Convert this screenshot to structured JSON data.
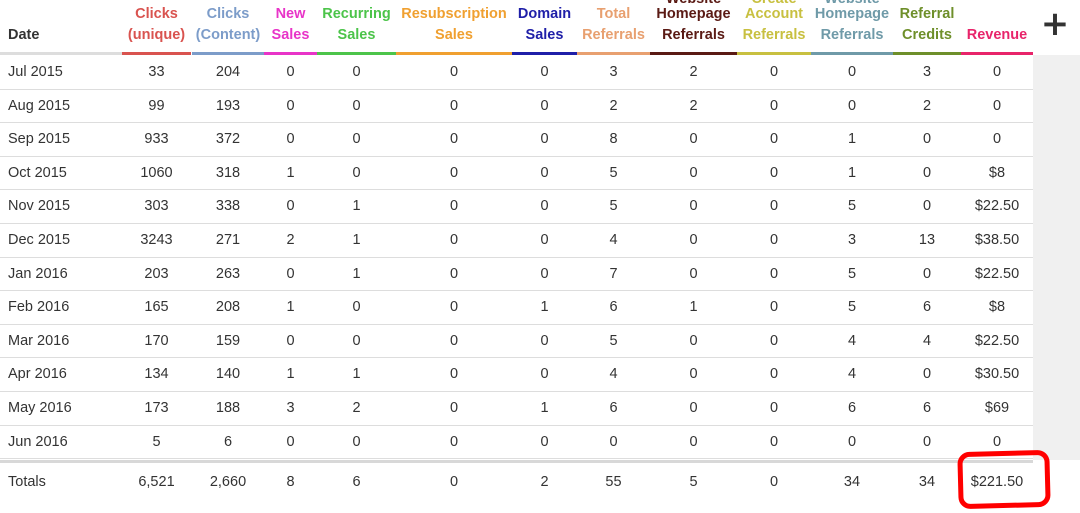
{
  "toolbar": {
    "add_icon_glyph": "+"
  },
  "columns": [
    {
      "key": "date",
      "label": "Date",
      "color": "#333333",
      "underline": "#dddddd"
    },
    {
      "key": "clicks_u",
      "label": "Clicks\n(unique)",
      "color": "#d9534f",
      "underline": "#d9534f"
    },
    {
      "key": "clicks_c",
      "label": "Clicks\n(Content)",
      "color": "#7c9cc9",
      "underline": "#7c9cc9"
    },
    {
      "key": "new",
      "label": "New\nSales",
      "color": "#e834c8",
      "underline": "#e834c8"
    },
    {
      "key": "recur",
      "label": "Recurring\nSales",
      "color": "#4cc44a",
      "underline": "#4cc44a"
    },
    {
      "key": "resub",
      "label": "Resubscription\nSales",
      "color": "#f0a030",
      "underline": "#f0a030"
    },
    {
      "key": "domain",
      "label": "Domain\nSales",
      "color": "#1f1fa8",
      "underline": "#1f1fa8"
    },
    {
      "key": "total_ref",
      "label": "Total\nReferrals",
      "color": "#e8a070",
      "underline": "#e8a070"
    },
    {
      "key": "home_ref",
      "label": "Homepage\nReferrals",
      "color": "#5a1a14",
      "underline": "#5a1a14",
      "cropped": "Website"
    },
    {
      "key": "acct_ref",
      "label": "Account\nReferrals",
      "color": "#c8c040",
      "underline": "#c8c040",
      "cropped": "Create"
    },
    {
      "key": "whome_ref",
      "label": "Homepage\nReferrals",
      "color": "#6f9aa8",
      "underline": "#6f9aa8",
      "cropped": "Website"
    },
    {
      "key": "ref_cred",
      "label": "Referral\nCredits",
      "color": "#6e8f2a",
      "underline": "#6e8f2a"
    },
    {
      "key": "revenue",
      "label": "Revenue",
      "color": "#e8246a",
      "underline": "#e8246a"
    }
  ],
  "rows": [
    [
      "Jul 2015",
      "33",
      "204",
      "0",
      "0",
      "0",
      "0",
      "3",
      "2",
      "0",
      "0",
      "3",
      "0"
    ],
    [
      "Aug 2015",
      "99",
      "193",
      "0",
      "0",
      "0",
      "0",
      "2",
      "2",
      "0",
      "0",
      "2",
      "0"
    ],
    [
      "Sep 2015",
      "933",
      "372",
      "0",
      "0",
      "0",
      "0",
      "8",
      "0",
      "0",
      "1",
      "0",
      "0"
    ],
    [
      "Oct 2015",
      "1060",
      "318",
      "1",
      "0",
      "0",
      "0",
      "5",
      "0",
      "0",
      "1",
      "0",
      "$8"
    ],
    [
      "Nov 2015",
      "303",
      "338",
      "0",
      "1",
      "0",
      "0",
      "5",
      "0",
      "0",
      "5",
      "0",
      "$22.50"
    ],
    [
      "Dec 2015",
      "3243",
      "271",
      "2",
      "1",
      "0",
      "0",
      "4",
      "0",
      "0",
      "3",
      "13",
      "$38.50"
    ],
    [
      "Jan 2016",
      "203",
      "263",
      "0",
      "1",
      "0",
      "0",
      "7",
      "0",
      "0",
      "5",
      "0",
      "$22.50"
    ],
    [
      "Feb 2016",
      "165",
      "208",
      "1",
      "0",
      "0",
      "1",
      "6",
      "1",
      "0",
      "5",
      "6",
      "$8"
    ],
    [
      "Mar 2016",
      "170",
      "159",
      "0",
      "0",
      "0",
      "0",
      "5",
      "0",
      "0",
      "4",
      "4",
      "$22.50"
    ],
    [
      "Apr 2016",
      "134",
      "140",
      "1",
      "1",
      "0",
      "0",
      "4",
      "0",
      "0",
      "4",
      "0",
      "$30.50"
    ],
    [
      "May 2016",
      "173",
      "188",
      "3",
      "2",
      "0",
      "1",
      "6",
      "0",
      "0",
      "6",
      "6",
      "$69"
    ],
    [
      "Jun 2016",
      "5",
      "6",
      "0",
      "0",
      "0",
      "0",
      "0",
      "0",
      "0",
      "0",
      "0",
      "0"
    ]
  ],
  "totals": [
    "Totals",
    "6,521",
    "2,660",
    "8",
    "6",
    "0",
    "2",
    "55",
    "5",
    "0",
    "34",
    "34",
    "$221.50"
  ],
  "annotation": {
    "color": "#ff0000"
  }
}
